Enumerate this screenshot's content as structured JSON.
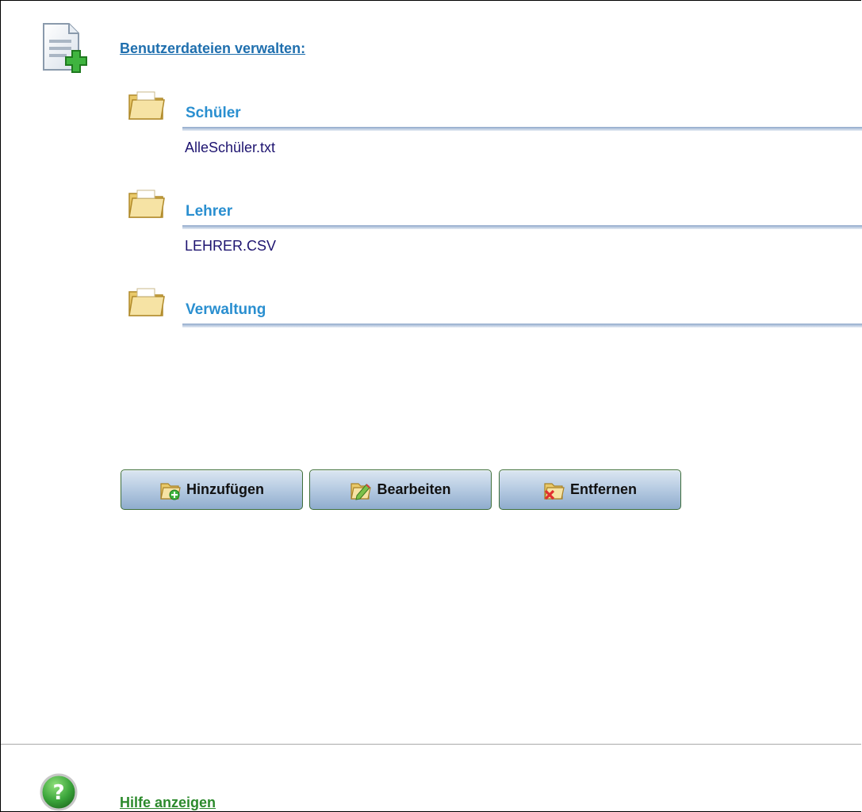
{
  "header": {
    "title": "Benutzerdateien verwalten:",
    "icon": "document-add-icon"
  },
  "groups": [
    {
      "title": "Schüler",
      "icon": "folder-icon",
      "files": [
        "AlleSchüler.txt"
      ]
    },
    {
      "title": "Lehrer",
      "icon": "folder-icon",
      "files": [
        "LEHRER.CSV"
      ]
    },
    {
      "title": "Verwaltung",
      "icon": "folder-icon",
      "files": []
    }
  ],
  "toolbar": {
    "add_label": "Hinzufügen",
    "edit_label": "Bearbeiten",
    "remove_label": "Entfernen"
  },
  "footer": {
    "help_label": "Hilfe anzeigen",
    "icon": "help-icon"
  },
  "colors": {
    "link_blue": "#1f6fae",
    "group_title_blue": "#2a8fd0",
    "file_text": "#1e1470",
    "help_green": "#2c8a2c",
    "button_border": "#3f6f3a"
  }
}
